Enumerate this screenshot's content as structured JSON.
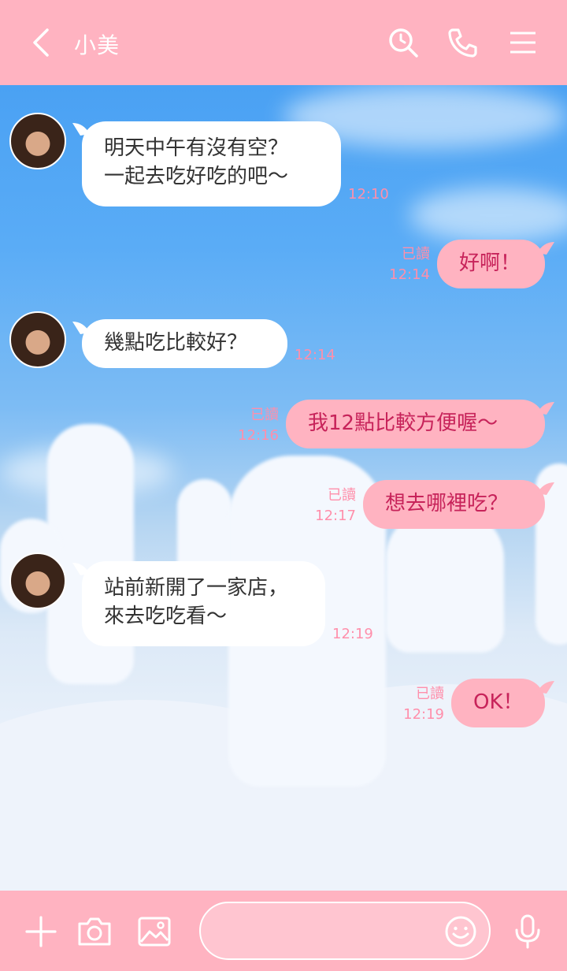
{
  "header": {
    "title": "小美",
    "icons": [
      "back-icon",
      "search-icon",
      "phone-icon",
      "menu-icon"
    ]
  },
  "messages": [
    {
      "direction": "in",
      "text": "明天中午有沒有空？\n一起去吃好吃的吧～",
      "time": "12:10"
    },
    {
      "direction": "out",
      "text": "好啊！",
      "read": "已讀",
      "time": "12:14"
    },
    {
      "direction": "in",
      "text": "幾點吃比較好？",
      "time": "12:14"
    },
    {
      "direction": "out",
      "text": "我12點比較方便喔～",
      "read": "已讀",
      "time": "12:16"
    },
    {
      "direction": "out",
      "text": "想去哪裡吃？",
      "read": "已讀",
      "time": "12:17"
    },
    {
      "direction": "in",
      "text": "站前新開了一家店，\n來去吃吃看～",
      "time": "12:19"
    },
    {
      "direction": "out",
      "text": "OK！",
      "read": "已讀",
      "time": "12:19"
    }
  ],
  "footer": {
    "input_placeholder": "",
    "icons": [
      "plus-icon",
      "camera-icon",
      "image-icon",
      "emoji-icon",
      "microphone-icon"
    ]
  },
  "colors": {
    "accent": "#ffb3c1",
    "out_text": "#c7235a",
    "meta": "#ff8fab"
  }
}
